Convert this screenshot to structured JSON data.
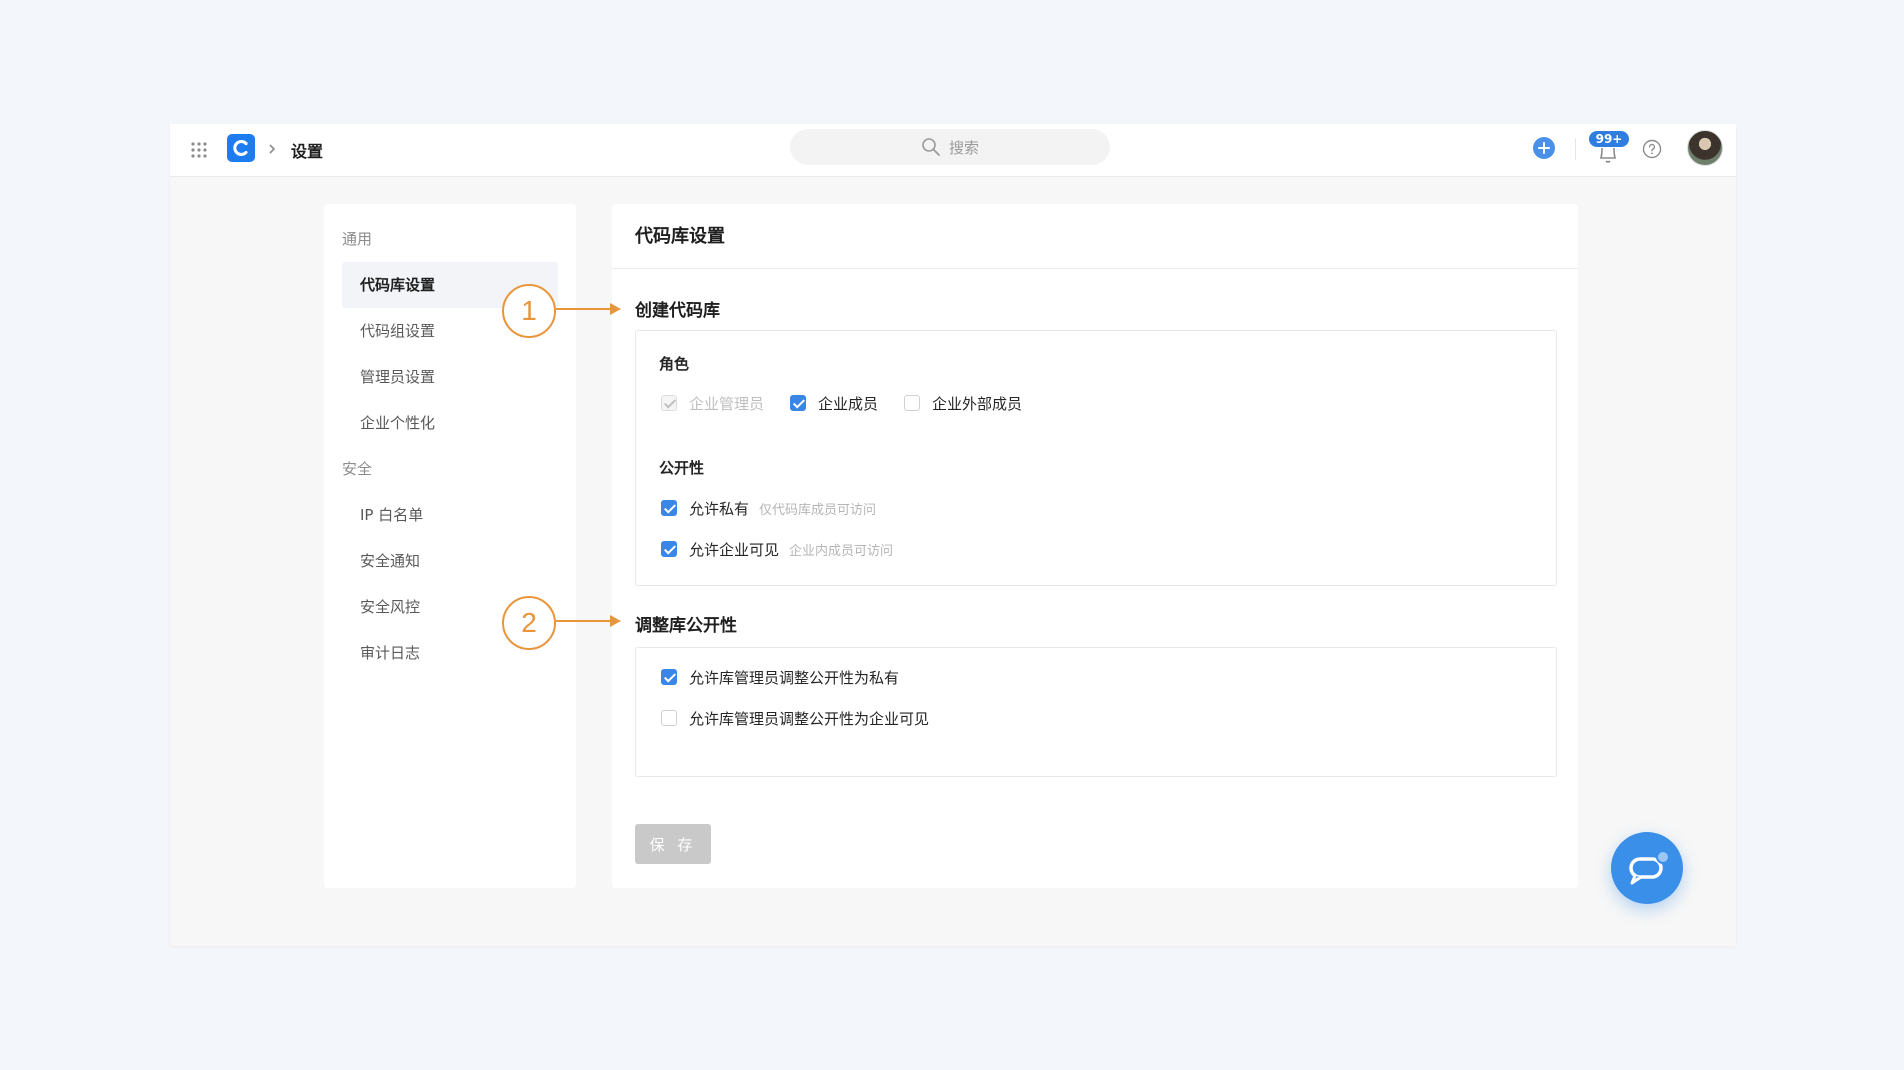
{
  "topbar": {
    "breadcrumb_title": "设置",
    "search_placeholder": "搜索",
    "notification_badge": "99+"
  },
  "sidebar": {
    "groups": [
      {
        "label": "通用",
        "items": [
          "代码库设置",
          "代码组设置",
          "管理员设置",
          "企业个性化"
        ]
      },
      {
        "label": "安全",
        "items": [
          "IP 白名单",
          "安全通知",
          "安全风控",
          "审计日志"
        ]
      }
    ],
    "active_item": "代码库设置"
  },
  "main": {
    "title": "代码库设置",
    "create_section": {
      "title": "创建代码库",
      "role_label": "角色",
      "roles": [
        {
          "label": "企业管理员",
          "checked": true,
          "disabled": true
        },
        {
          "label": "企业成员",
          "checked": true,
          "disabled": false
        },
        {
          "label": "企业外部成员",
          "checked": false,
          "disabled": false
        }
      ],
      "visibility_label": "公开性",
      "visibility": [
        {
          "label": "允许私有",
          "hint": "仅代码库成员可访问",
          "checked": true
        },
        {
          "label": "允许企业可见",
          "hint": "企业内成员可访问",
          "checked": true
        }
      ]
    },
    "adjust_section": {
      "title": "调整库公开性",
      "options": [
        {
          "label": "允许库管理员调整公开性为私有",
          "checked": true
        },
        {
          "label": "允许库管理员调整公开性为企业可见",
          "checked": false
        }
      ]
    },
    "save_label": "保 存"
  },
  "annotations": {
    "one": "1",
    "two": "2",
    "color": "#e9953b"
  },
  "colors": {
    "primary": "#3a86e6",
    "accent_annotation": "#e9953b"
  }
}
